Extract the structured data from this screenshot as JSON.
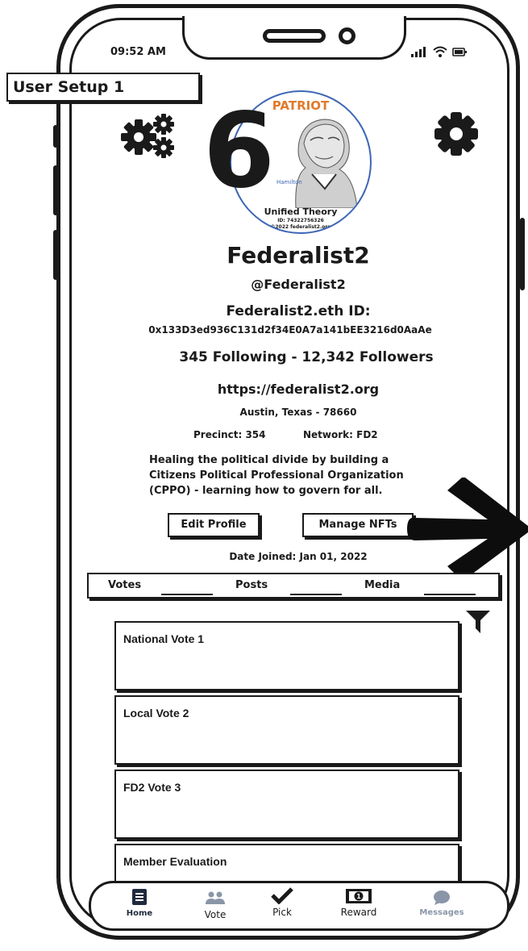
{
  "screen_label": "User Setup 1",
  "status_bar": {
    "time": "09:52 AM"
  },
  "badge": {
    "number": "6"
  },
  "seal": {
    "top_text": "PATRIOT",
    "portrait_label": "Hamilton",
    "title": "Unified Theory",
    "id_line": "ID: 74322756326",
    "copyright": "©2022 federalist2.org",
    "ring_color": "#3d66b5",
    "accent_color": "#e07a2b"
  },
  "profile": {
    "name": "Federalist2",
    "handle": "@Federalist2",
    "eth_label": "Federalist2.eth ID:",
    "eth_address": "0x133D3ed936C131d2f34E0A7a141bEE3216d0AaAe",
    "stats": "345 Following  -  12,342 Followers",
    "website": "https://federalist2.org",
    "location": "Austin, Texas - 78660",
    "precinct": "Precinct:  354",
    "network": "Network: FD2",
    "bio": [
      "Healing the political divide by building a",
      "Citizens Political Professional Organization",
      "(CPPO) - learning how to govern for all."
    ],
    "edit_button": "Edit Profile",
    "nfts_button": "Manage NFTs",
    "date_joined": "Date Joined: Jan 01, 2022"
  },
  "tabs": [
    {
      "label": "Votes"
    },
    {
      "label": "Posts"
    },
    {
      "label": "Media"
    }
  ],
  "cards": [
    {
      "title": "National Vote 1"
    },
    {
      "title": "Local Vote 2"
    },
    {
      "title": "FD2 Vote 3"
    },
    {
      "title": "Member Evaluation"
    }
  ],
  "bottom_nav": [
    {
      "label": "Home",
      "icon": "document-icon"
    },
    {
      "label": "Vote",
      "icon": "users-icon"
    },
    {
      "label": "Pick",
      "icon": "checkmark-icon"
    },
    {
      "label": "Reward",
      "icon": "dollar-bill-icon"
    },
    {
      "label": "Messages",
      "icon": "chat-bubble-icon"
    }
  ],
  "colors": {
    "ink": "#1a1a1a",
    "muted_nav": "#8a96a8"
  }
}
